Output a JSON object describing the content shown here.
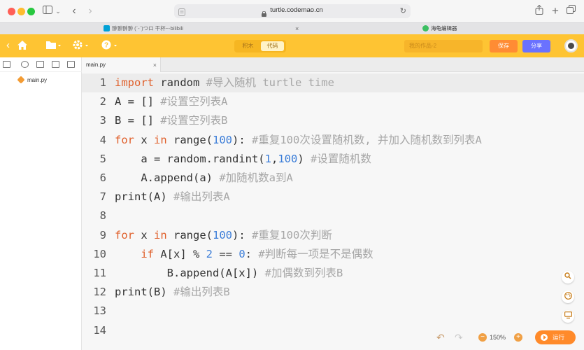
{
  "browser": {
    "url": "turtle.codemao.cn",
    "tabs": [
      {
        "label": "翀翀翀翀 (ˊ-ˋ)つロ 干杯~-bilibili"
      },
      {
        "label": "海龟编辑器"
      }
    ]
  },
  "app": {
    "mode_options": [
      "积木",
      "代码"
    ],
    "active_mode": "代码",
    "work_name_placeholder": "我的作品-2",
    "save_label": "保存",
    "share_label": "分享",
    "zoom": "150%",
    "run_label": "运行"
  },
  "sidebar": {
    "files": [
      "main.py"
    ]
  },
  "editor": {
    "tab": "main.py",
    "lines": [
      {
        "n": "1",
        "html": "<span class='kw'>import</span> random <span class='cm'>#导入随机 turtle time</span>"
      },
      {
        "n": "2",
        "html": "A = [] <span class='cm'>#设置空列表A</span>"
      },
      {
        "n": "3",
        "html": "B = [] <span class='cm'>#设置空列表B</span>"
      },
      {
        "n": "4",
        "html": "<span class='kw'>for</span> x <span class='kw'>in</span> range(<span class='num'>100</span>): <span class='cm'>#重复100次设置随机数, 并加入随机数到列表A</span>"
      },
      {
        "n": "5",
        "html": "    a = random.randint(<span class='num'>1</span>,<span class='num'>100</span>) <span class='cm'>#设置随机数</span>"
      },
      {
        "n": "6",
        "html": "    A.append(a) <span class='cm'>#加随机数a到A</span>"
      },
      {
        "n": "7",
        "html": "print(A) <span class='cm'>#输出列表A</span>"
      },
      {
        "n": "8",
        "html": ""
      },
      {
        "n": "9",
        "html": "<span class='kw'>for</span> x <span class='kw'>in</span> range(<span class='num'>100</span>): <span class='cm'>#重复100次判断</span>"
      },
      {
        "n": "10",
        "html": "    <span class='kw'>if</span> A[x] % <span class='num'>2</span> == <span class='num'>0</span>: <span class='cm'>#判断每一项是不是偶数</span>"
      },
      {
        "n": "11",
        "html": "        B.append(A[x]) <span class='cm'>#加偶数到列表B</span>"
      },
      {
        "n": "12",
        "html": "print(B) <span class='cm'>#输出列表B</span>"
      },
      {
        "n": "13",
        "html": ""
      },
      {
        "n": "14",
        "html": ""
      }
    ]
  },
  "icons": {
    "home": "home-icon",
    "folder": "folder-icon",
    "gear": "gear-icon",
    "help": "help-icon",
    "search": "search-icon",
    "palette": "palette-icon",
    "screen": "screen-icon"
  }
}
